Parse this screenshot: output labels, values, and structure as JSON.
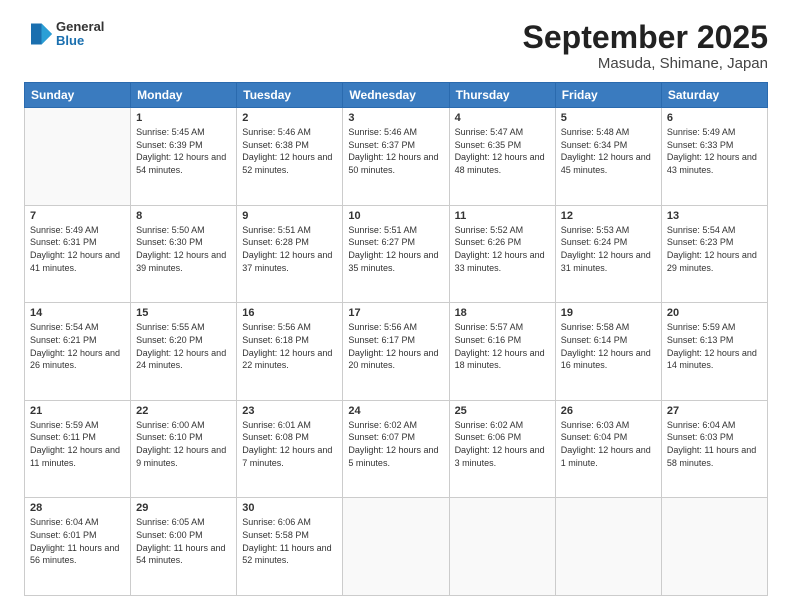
{
  "logo": {
    "general": "General",
    "blue": "Blue"
  },
  "title": "September 2025",
  "subtitle": "Masuda, Shimane, Japan",
  "days": [
    "Sunday",
    "Monday",
    "Tuesday",
    "Wednesday",
    "Thursday",
    "Friday",
    "Saturday"
  ],
  "weeks": [
    [
      {
        "day": "",
        "sunrise": "",
        "sunset": "",
        "daylight": ""
      },
      {
        "day": "1",
        "sunrise": "Sunrise: 5:45 AM",
        "sunset": "Sunset: 6:39 PM",
        "daylight": "Daylight: 12 hours and 54 minutes."
      },
      {
        "day": "2",
        "sunrise": "Sunrise: 5:46 AM",
        "sunset": "Sunset: 6:38 PM",
        "daylight": "Daylight: 12 hours and 52 minutes."
      },
      {
        "day": "3",
        "sunrise": "Sunrise: 5:46 AM",
        "sunset": "Sunset: 6:37 PM",
        "daylight": "Daylight: 12 hours and 50 minutes."
      },
      {
        "day": "4",
        "sunrise": "Sunrise: 5:47 AM",
        "sunset": "Sunset: 6:35 PM",
        "daylight": "Daylight: 12 hours and 48 minutes."
      },
      {
        "day": "5",
        "sunrise": "Sunrise: 5:48 AM",
        "sunset": "Sunset: 6:34 PM",
        "daylight": "Daylight: 12 hours and 45 minutes."
      },
      {
        "day": "6",
        "sunrise": "Sunrise: 5:49 AM",
        "sunset": "Sunset: 6:33 PM",
        "daylight": "Daylight: 12 hours and 43 minutes."
      }
    ],
    [
      {
        "day": "7",
        "sunrise": "Sunrise: 5:49 AM",
        "sunset": "Sunset: 6:31 PM",
        "daylight": "Daylight: 12 hours and 41 minutes."
      },
      {
        "day": "8",
        "sunrise": "Sunrise: 5:50 AM",
        "sunset": "Sunset: 6:30 PM",
        "daylight": "Daylight: 12 hours and 39 minutes."
      },
      {
        "day": "9",
        "sunrise": "Sunrise: 5:51 AM",
        "sunset": "Sunset: 6:28 PM",
        "daylight": "Daylight: 12 hours and 37 minutes."
      },
      {
        "day": "10",
        "sunrise": "Sunrise: 5:51 AM",
        "sunset": "Sunset: 6:27 PM",
        "daylight": "Daylight: 12 hours and 35 minutes."
      },
      {
        "day": "11",
        "sunrise": "Sunrise: 5:52 AM",
        "sunset": "Sunset: 6:26 PM",
        "daylight": "Daylight: 12 hours and 33 minutes."
      },
      {
        "day": "12",
        "sunrise": "Sunrise: 5:53 AM",
        "sunset": "Sunset: 6:24 PM",
        "daylight": "Daylight: 12 hours and 31 minutes."
      },
      {
        "day": "13",
        "sunrise": "Sunrise: 5:54 AM",
        "sunset": "Sunset: 6:23 PM",
        "daylight": "Daylight: 12 hours and 29 minutes."
      }
    ],
    [
      {
        "day": "14",
        "sunrise": "Sunrise: 5:54 AM",
        "sunset": "Sunset: 6:21 PM",
        "daylight": "Daylight: 12 hours and 26 minutes."
      },
      {
        "day": "15",
        "sunrise": "Sunrise: 5:55 AM",
        "sunset": "Sunset: 6:20 PM",
        "daylight": "Daylight: 12 hours and 24 minutes."
      },
      {
        "day": "16",
        "sunrise": "Sunrise: 5:56 AM",
        "sunset": "Sunset: 6:18 PM",
        "daylight": "Daylight: 12 hours and 22 minutes."
      },
      {
        "day": "17",
        "sunrise": "Sunrise: 5:56 AM",
        "sunset": "Sunset: 6:17 PM",
        "daylight": "Daylight: 12 hours and 20 minutes."
      },
      {
        "day": "18",
        "sunrise": "Sunrise: 5:57 AM",
        "sunset": "Sunset: 6:16 PM",
        "daylight": "Daylight: 12 hours and 18 minutes."
      },
      {
        "day": "19",
        "sunrise": "Sunrise: 5:58 AM",
        "sunset": "Sunset: 6:14 PM",
        "daylight": "Daylight: 12 hours and 16 minutes."
      },
      {
        "day": "20",
        "sunrise": "Sunrise: 5:59 AM",
        "sunset": "Sunset: 6:13 PM",
        "daylight": "Daylight: 12 hours and 14 minutes."
      }
    ],
    [
      {
        "day": "21",
        "sunrise": "Sunrise: 5:59 AM",
        "sunset": "Sunset: 6:11 PM",
        "daylight": "Daylight: 12 hours and 11 minutes."
      },
      {
        "day": "22",
        "sunrise": "Sunrise: 6:00 AM",
        "sunset": "Sunset: 6:10 PM",
        "daylight": "Daylight: 12 hours and 9 minutes."
      },
      {
        "day": "23",
        "sunrise": "Sunrise: 6:01 AM",
        "sunset": "Sunset: 6:08 PM",
        "daylight": "Daylight: 12 hours and 7 minutes."
      },
      {
        "day": "24",
        "sunrise": "Sunrise: 6:02 AM",
        "sunset": "Sunset: 6:07 PM",
        "daylight": "Daylight: 12 hours and 5 minutes."
      },
      {
        "day": "25",
        "sunrise": "Sunrise: 6:02 AM",
        "sunset": "Sunset: 6:06 PM",
        "daylight": "Daylight: 12 hours and 3 minutes."
      },
      {
        "day": "26",
        "sunrise": "Sunrise: 6:03 AM",
        "sunset": "Sunset: 6:04 PM",
        "daylight": "Daylight: 12 hours and 1 minute."
      },
      {
        "day": "27",
        "sunrise": "Sunrise: 6:04 AM",
        "sunset": "Sunset: 6:03 PM",
        "daylight": "Daylight: 11 hours and 58 minutes."
      }
    ],
    [
      {
        "day": "28",
        "sunrise": "Sunrise: 6:04 AM",
        "sunset": "Sunset: 6:01 PM",
        "daylight": "Daylight: 11 hours and 56 minutes."
      },
      {
        "day": "29",
        "sunrise": "Sunrise: 6:05 AM",
        "sunset": "Sunset: 6:00 PM",
        "daylight": "Daylight: 11 hours and 54 minutes."
      },
      {
        "day": "30",
        "sunrise": "Sunrise: 6:06 AM",
        "sunset": "Sunset: 5:58 PM",
        "daylight": "Daylight: 11 hours and 52 minutes."
      },
      {
        "day": "",
        "sunrise": "",
        "sunset": "",
        "daylight": ""
      },
      {
        "day": "",
        "sunrise": "",
        "sunset": "",
        "daylight": ""
      },
      {
        "day": "",
        "sunrise": "",
        "sunset": "",
        "daylight": ""
      },
      {
        "day": "",
        "sunrise": "",
        "sunset": "",
        "daylight": ""
      }
    ]
  ]
}
